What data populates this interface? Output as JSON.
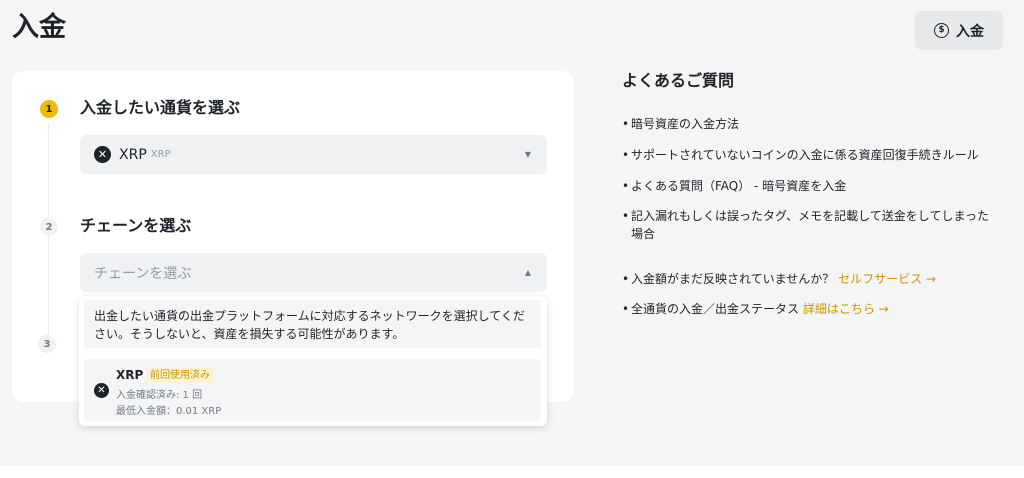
{
  "page": {
    "title": "入金"
  },
  "header": {
    "deposit_button": {
      "label": "入金",
      "icon_glyph": "$"
    }
  },
  "steps": [
    {
      "number": "1",
      "title": "入金したい通貨を選ぶ"
    },
    {
      "number": "2",
      "title": "チェーンを選ぶ"
    },
    {
      "number": "3"
    }
  ],
  "coin_select": {
    "name": "XRP",
    "sub": "XRP",
    "icon_glyph": "✕",
    "arrow": "▼"
  },
  "chain_select": {
    "placeholder": "チェーンを選ぶ",
    "arrow": "▲"
  },
  "chain_dropdown": {
    "notice": "出金したい通貨の出金プラットフォームに対応するネットワークを選択してください。そうしないと、資産を損失する可能性があります。",
    "options": [
      {
        "name": "XRP",
        "badge": "前回使用済み",
        "confirmations": "入金確認済み: 1 回",
        "min_deposit": "最低入金額：0.01 XRP"
      }
    ]
  },
  "faq": {
    "title": "よくあるご質問",
    "bullet": "•",
    "items": [
      {
        "text": "暗号資産の入金方法"
      },
      {
        "text": "サポートされていないコインの入金に係る資産回復手続きルール"
      },
      {
        "text": "よくある質問（FAQ） - 暗号資産を入金"
      },
      {
        "text": "記入漏れもしくは誤ったタグ、メモを記載して送金をしてしまった場合"
      }
    ],
    "extra": [
      {
        "text": "入金額がまだ反映されていませんか？ ",
        "link": "セルフサービス →"
      },
      {
        "text": "全通貨の入金／出金ステータス ",
        "link": "詳細はこちら →"
      }
    ]
  },
  "colors": {
    "accent": "#f0b90b",
    "link": "#c99400",
    "text": "#1e2329"
  }
}
